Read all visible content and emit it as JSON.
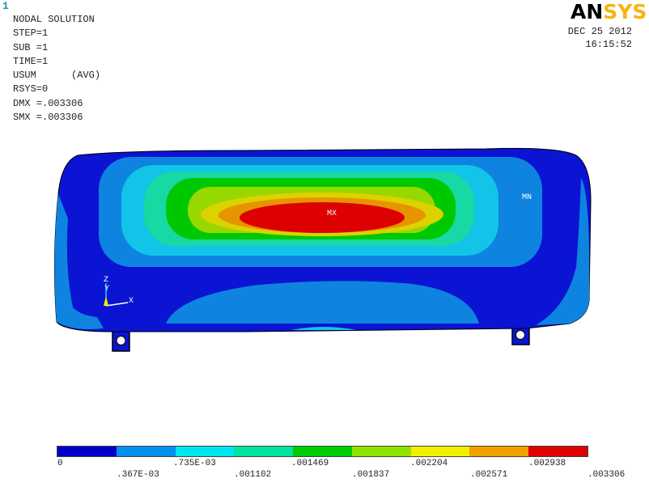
{
  "window_index": "1",
  "header": {
    "title": "NODAL SOLUTION",
    "lines": [
      "STEP=1",
      "SUB =1",
      "TIME=1",
      "USUM      (AVG)",
      "RSYS=0",
      "DMX =.003306",
      "SMX =.003306"
    ]
  },
  "brand": {
    "an": "AN",
    "sys": "SYS"
  },
  "timestamp": {
    "date": "DEC 25 2012",
    "time": "16:15:52"
  },
  "markers": {
    "max": "MX",
    "min": "MN"
  },
  "triad": {
    "z": "Z",
    "y": "Y",
    "x": "X"
  },
  "legend": {
    "colors": [
      "#0000c8",
      "#0090ee",
      "#00e6ee",
      "#00e2a0",
      "#00cc00",
      "#90e200",
      "#f0f000",
      "#f2a000",
      "#e00000"
    ],
    "top_labels": [
      "0",
      ".735E-03",
      ".001469",
      ".002204",
      ".002938"
    ],
    "bottom_labels": [
      ".367E-03",
      ".001102",
      ".001837",
      ".002571",
      ".003306"
    ]
  },
  "colors": {
    "contour_min": "#0a14d2",
    "contour_1": "#0e84e0",
    "contour_2": "#12c4e8",
    "contour_3": "#17d9a3",
    "contour_4": "#00c800",
    "contour_5": "#96d800",
    "contour_6": "#dcd200",
    "contour_7": "#e69400",
    "contour_max": "#dc0000"
  }
}
